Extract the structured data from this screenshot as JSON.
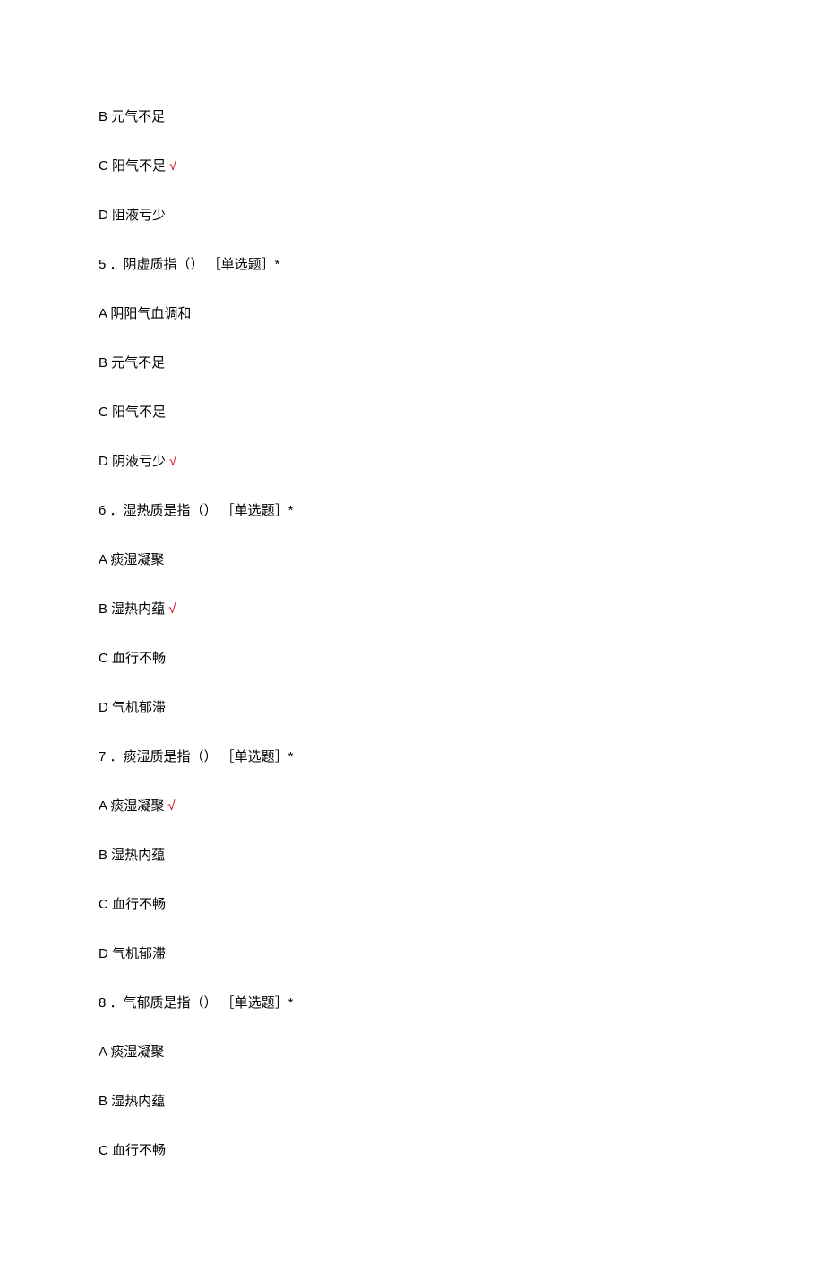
{
  "lines": [
    {
      "text": "B 元气不足",
      "correct": false
    },
    {
      "text": "C 阳气不足",
      "correct": true
    },
    {
      "text": "D 阻液亏少",
      "correct": false
    },
    {
      "text": "5 ．阴虚质指（） ［单选题］*",
      "correct": false
    },
    {
      "text": "A 阴阳气血调和",
      "correct": false
    },
    {
      "text": "B 元气不足",
      "correct": false
    },
    {
      "text": "C 阳气不足",
      "correct": false
    },
    {
      "text": "D 阴液亏少",
      "correct": true
    },
    {
      "text": "6 ．湿热质是指（） ［单选题］*",
      "correct": false
    },
    {
      "text": "A 痰湿凝聚",
      "correct": false
    },
    {
      "text": "B 湿热内蕴",
      "correct": true
    },
    {
      "text": "C 血行不畅",
      "correct": false
    },
    {
      "text": "D 气机郁滞",
      "correct": false
    },
    {
      "text": "7 ．痰湿质是指（） ［单选题］*",
      "correct": false
    },
    {
      "text": "A 痰湿凝聚",
      "correct": true
    },
    {
      "text": "B 湿热内蕴",
      "correct": false
    },
    {
      "text": "C 血行不畅",
      "correct": false
    },
    {
      "text": "D 气机郁滞",
      "correct": false
    },
    {
      "text": "8 ．气郁质是指（） ［单选题］*",
      "correct": false
    },
    {
      "text": "A 痰湿凝聚",
      "correct": false
    },
    {
      "text": "B 湿热内蕴",
      "correct": false
    },
    {
      "text": "C 血行不畅",
      "correct": false
    }
  ],
  "checkmark": "√"
}
